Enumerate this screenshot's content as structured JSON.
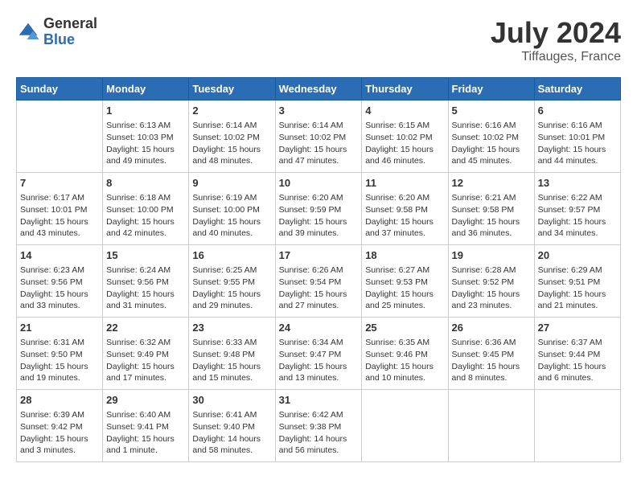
{
  "logo": {
    "general": "General",
    "blue": "Blue"
  },
  "title": {
    "month_year": "July 2024",
    "location": "Tiffauges, France"
  },
  "days_of_week": [
    "Sunday",
    "Monday",
    "Tuesday",
    "Wednesday",
    "Thursday",
    "Friday",
    "Saturday"
  ],
  "weeks": [
    [
      {
        "day": "",
        "sunrise": "",
        "sunset": "",
        "daylight": ""
      },
      {
        "day": "1",
        "sunrise": "6:13 AM",
        "sunset": "10:03 PM",
        "daylight": "15 hours and 49 minutes."
      },
      {
        "day": "2",
        "sunrise": "6:14 AM",
        "sunset": "10:02 PM",
        "daylight": "15 hours and 48 minutes."
      },
      {
        "day": "3",
        "sunrise": "6:14 AM",
        "sunset": "10:02 PM",
        "daylight": "15 hours and 47 minutes."
      },
      {
        "day": "4",
        "sunrise": "6:15 AM",
        "sunset": "10:02 PM",
        "daylight": "15 hours and 46 minutes."
      },
      {
        "day": "5",
        "sunrise": "6:16 AM",
        "sunset": "10:02 PM",
        "daylight": "15 hours and 45 minutes."
      },
      {
        "day": "6",
        "sunrise": "6:16 AM",
        "sunset": "10:01 PM",
        "daylight": "15 hours and 44 minutes."
      }
    ],
    [
      {
        "day": "7",
        "sunrise": "6:17 AM",
        "sunset": "10:01 PM",
        "daylight": "15 hours and 43 minutes."
      },
      {
        "day": "8",
        "sunrise": "6:18 AM",
        "sunset": "10:00 PM",
        "daylight": "15 hours and 42 minutes."
      },
      {
        "day": "9",
        "sunrise": "6:19 AM",
        "sunset": "10:00 PM",
        "daylight": "15 hours and 40 minutes."
      },
      {
        "day": "10",
        "sunrise": "6:20 AM",
        "sunset": "9:59 PM",
        "daylight": "15 hours and 39 minutes."
      },
      {
        "day": "11",
        "sunrise": "6:20 AM",
        "sunset": "9:58 PM",
        "daylight": "15 hours and 37 minutes."
      },
      {
        "day": "12",
        "sunrise": "6:21 AM",
        "sunset": "9:58 PM",
        "daylight": "15 hours and 36 minutes."
      },
      {
        "day": "13",
        "sunrise": "6:22 AM",
        "sunset": "9:57 PM",
        "daylight": "15 hours and 34 minutes."
      }
    ],
    [
      {
        "day": "14",
        "sunrise": "6:23 AM",
        "sunset": "9:56 PM",
        "daylight": "15 hours and 33 minutes."
      },
      {
        "day": "15",
        "sunrise": "6:24 AM",
        "sunset": "9:56 PM",
        "daylight": "15 hours and 31 minutes."
      },
      {
        "day": "16",
        "sunrise": "6:25 AM",
        "sunset": "9:55 PM",
        "daylight": "15 hours and 29 minutes."
      },
      {
        "day": "17",
        "sunrise": "6:26 AM",
        "sunset": "9:54 PM",
        "daylight": "15 hours and 27 minutes."
      },
      {
        "day": "18",
        "sunrise": "6:27 AM",
        "sunset": "9:53 PM",
        "daylight": "15 hours and 25 minutes."
      },
      {
        "day": "19",
        "sunrise": "6:28 AM",
        "sunset": "9:52 PM",
        "daylight": "15 hours and 23 minutes."
      },
      {
        "day": "20",
        "sunrise": "6:29 AM",
        "sunset": "9:51 PM",
        "daylight": "15 hours and 21 minutes."
      }
    ],
    [
      {
        "day": "21",
        "sunrise": "6:31 AM",
        "sunset": "9:50 PM",
        "daylight": "15 hours and 19 minutes."
      },
      {
        "day": "22",
        "sunrise": "6:32 AM",
        "sunset": "9:49 PM",
        "daylight": "15 hours and 17 minutes."
      },
      {
        "day": "23",
        "sunrise": "6:33 AM",
        "sunset": "9:48 PM",
        "daylight": "15 hours and 15 minutes."
      },
      {
        "day": "24",
        "sunrise": "6:34 AM",
        "sunset": "9:47 PM",
        "daylight": "15 hours and 13 minutes."
      },
      {
        "day": "25",
        "sunrise": "6:35 AM",
        "sunset": "9:46 PM",
        "daylight": "15 hours and 10 minutes."
      },
      {
        "day": "26",
        "sunrise": "6:36 AM",
        "sunset": "9:45 PM",
        "daylight": "15 hours and 8 minutes."
      },
      {
        "day": "27",
        "sunrise": "6:37 AM",
        "sunset": "9:44 PM",
        "daylight": "15 hours and 6 minutes."
      }
    ],
    [
      {
        "day": "28",
        "sunrise": "6:39 AM",
        "sunset": "9:42 PM",
        "daylight": "15 hours and 3 minutes."
      },
      {
        "day": "29",
        "sunrise": "6:40 AM",
        "sunset": "9:41 PM",
        "daylight": "15 hours and 1 minute."
      },
      {
        "day": "30",
        "sunrise": "6:41 AM",
        "sunset": "9:40 PM",
        "daylight": "14 hours and 58 minutes."
      },
      {
        "day": "31",
        "sunrise": "6:42 AM",
        "sunset": "9:38 PM",
        "daylight": "14 hours and 56 minutes."
      },
      {
        "day": "",
        "sunrise": "",
        "sunset": "",
        "daylight": ""
      },
      {
        "day": "",
        "sunrise": "",
        "sunset": "",
        "daylight": ""
      },
      {
        "day": "",
        "sunrise": "",
        "sunset": "",
        "daylight": ""
      }
    ]
  ]
}
